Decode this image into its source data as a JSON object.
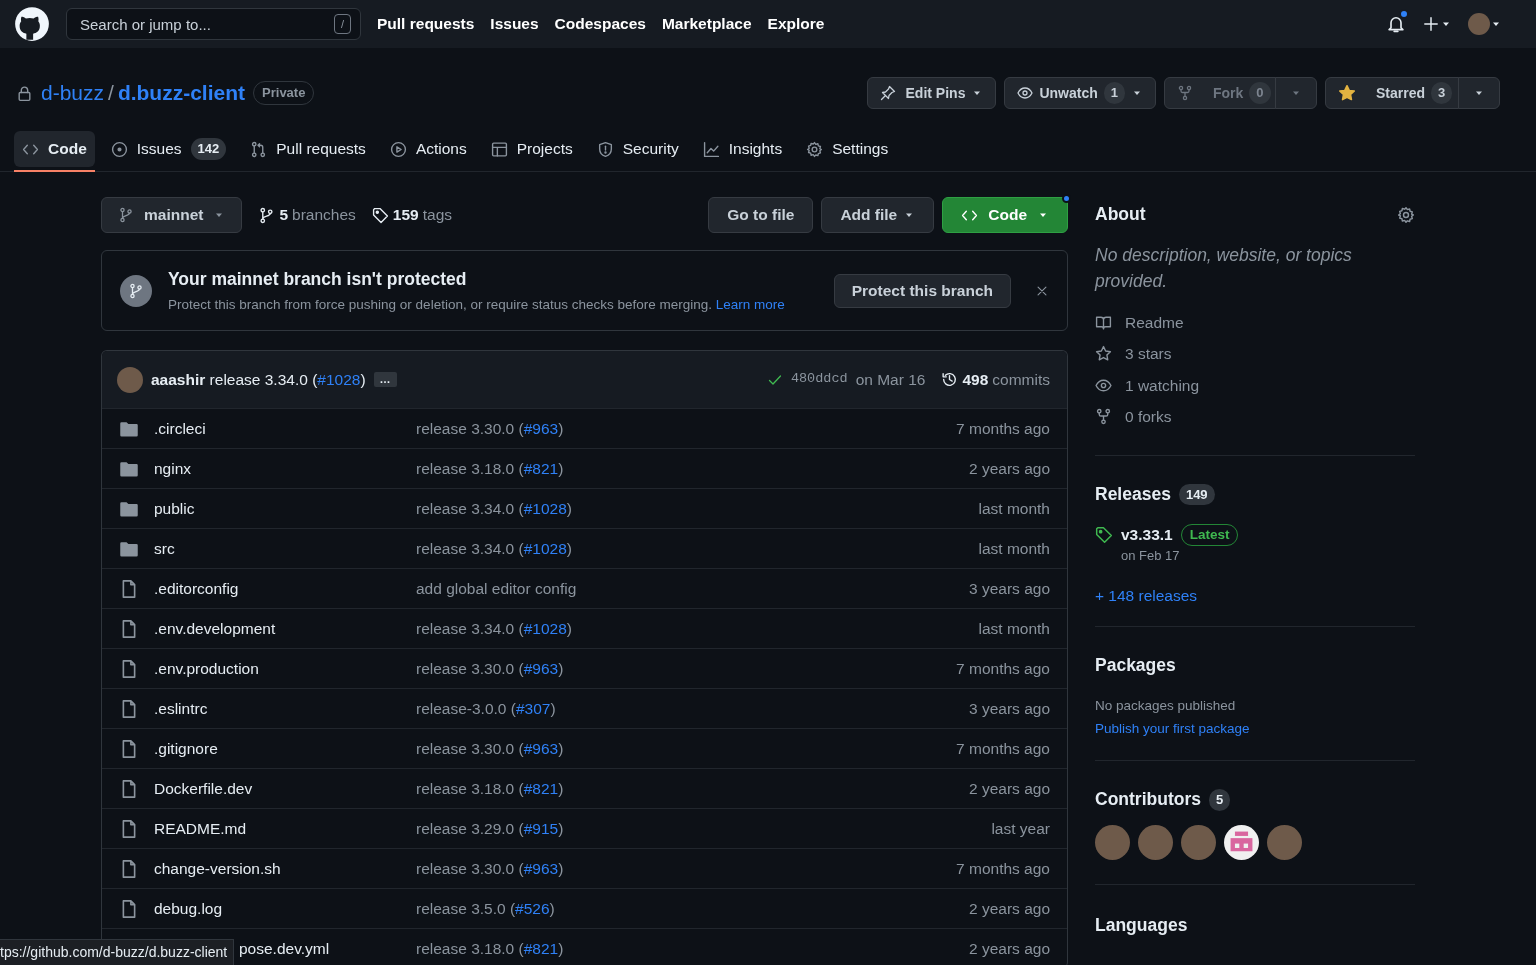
{
  "header": {
    "search_placeholder": "Search or jump to...",
    "search_key": "/",
    "nav": [
      "Pull requests",
      "Issues",
      "Codespaces",
      "Marketplace",
      "Explore"
    ],
    "notification_unread": true
  },
  "repo": {
    "owner": "d-buzz",
    "separator": "/",
    "name": "d.buzz-client",
    "visibility": "Private"
  },
  "repo_actions": [
    {
      "kind": "pins",
      "label": "Edit Pins",
      "disabled": false
    },
    {
      "kind": "watch",
      "label": "Unwatch",
      "count": "1",
      "disabled": false
    },
    {
      "kind": "fork",
      "label": "Fork",
      "count": "0",
      "disabled": true
    },
    {
      "kind": "star",
      "label": "Starred",
      "count": "3",
      "disabled": false
    }
  ],
  "tabs": [
    {
      "kind": "code",
      "label": "Code",
      "selected": true
    },
    {
      "kind": "issue",
      "label": "Issues",
      "count": "142",
      "selected": false
    },
    {
      "kind": "pr",
      "label": "Pull requests",
      "selected": false
    },
    {
      "kind": "play",
      "label": "Actions",
      "selected": false
    },
    {
      "kind": "table",
      "label": "Projects",
      "selected": false
    },
    {
      "kind": "shield",
      "label": "Security",
      "selected": false
    },
    {
      "kind": "graph",
      "label": "Insights",
      "selected": false
    },
    {
      "kind": "gear",
      "label": "Settings",
      "selected": false
    }
  ],
  "toolbar": {
    "branch": "mainnet",
    "branches_count": "5",
    "branches_label": "branches",
    "tags_count": "159",
    "tags_label": "tags",
    "buttons": [
      {
        "kind": "plain",
        "label": "Go to file"
      },
      {
        "kind": "dropdown",
        "label": "Add file"
      },
      {
        "kind": "code",
        "label": "Code"
      }
    ]
  },
  "banner": {
    "title": "Your mainnet branch isn't protected",
    "text": "Protect this branch from force pushing or deletion, or require status checks before merging.",
    "link": "Learn more",
    "button": "Protect this branch"
  },
  "latest_commit": {
    "author": "aaashir",
    "message_parts": [
      {
        "text": "release 3.34.0 ("
      },
      {
        "text": "#1028",
        "link": true
      },
      {
        "text": ")"
      }
    ],
    "more": "…",
    "status_ok": true,
    "sha": "480ddcd",
    "date": "on Mar 16",
    "commits_count": "498",
    "commits_label": "commits"
  },
  "files": [
    {
      "kind": "dir",
      "name": ".circleci",
      "message_parts": [
        {
          "text": "release 3.30.0 ("
        },
        {
          "text": "#963",
          "link": true
        },
        {
          "text": ")"
        }
      ],
      "time": "7 months ago"
    },
    {
      "kind": "dir",
      "name": "nginx",
      "message_parts": [
        {
          "text": "release 3.18.0 ("
        },
        {
          "text": "#821",
          "link": true
        },
        {
          "text": ")"
        }
      ],
      "time": "2 years ago"
    },
    {
      "kind": "dir",
      "name": "public",
      "message_parts": [
        {
          "text": "release 3.34.0 ("
        },
        {
          "text": "#1028",
          "link": true
        },
        {
          "text": ")"
        }
      ],
      "time": "last month"
    },
    {
      "kind": "dir",
      "name": "src",
      "message_parts": [
        {
          "text": "release 3.34.0 ("
        },
        {
          "text": "#1028",
          "link": true
        },
        {
          "text": ")"
        }
      ],
      "time": "last month"
    },
    {
      "kind": "file",
      "name": ".editorconfig",
      "message_parts": [
        {
          "text": "add global editor config"
        }
      ],
      "time": "3 years ago"
    },
    {
      "kind": "file",
      "name": ".env.development",
      "message_parts": [
        {
          "text": "release 3.34.0 ("
        },
        {
          "text": "#1028",
          "link": true
        },
        {
          "text": ")"
        }
      ],
      "time": "last month"
    },
    {
      "kind": "file",
      "name": ".env.production",
      "message_parts": [
        {
          "text": "release 3.30.0 ("
        },
        {
          "text": "#963",
          "link": true
        },
        {
          "text": ")"
        }
      ],
      "time": "7 months ago"
    },
    {
      "kind": "file",
      "name": ".eslintrc",
      "message_parts": [
        {
          "text": "release-3.0.0 ("
        },
        {
          "text": "#307",
          "link": true
        },
        {
          "text": ")"
        }
      ],
      "time": "3 years ago"
    },
    {
      "kind": "file",
      "name": ".gitignore",
      "message_parts": [
        {
          "text": "release 3.30.0 ("
        },
        {
          "text": "#963",
          "link": true
        },
        {
          "text": ")"
        }
      ],
      "time": "7 months ago"
    },
    {
      "kind": "file",
      "name": "Dockerfile.dev",
      "message_parts": [
        {
          "text": "release 3.18.0 ("
        },
        {
          "text": "#821",
          "link": true
        },
        {
          "text": ")"
        }
      ],
      "time": "2 years ago"
    },
    {
      "kind": "file",
      "name": "README.md",
      "message_parts": [
        {
          "text": "release 3.29.0 ("
        },
        {
          "text": "#915",
          "link": true
        },
        {
          "text": ")"
        }
      ],
      "time": "last year"
    },
    {
      "kind": "file",
      "name": "change-version.sh",
      "message_parts": [
        {
          "text": "release 3.30.0 ("
        },
        {
          "text": "#963",
          "link": true
        },
        {
          "text": ")"
        }
      ],
      "time": "7 months ago"
    },
    {
      "kind": "file",
      "name": "debug.log",
      "message_parts": [
        {
          "text": "release 3.5.0 ("
        },
        {
          "text": "#526",
          "link": true
        },
        {
          "text": ")"
        }
      ],
      "time": "2 years ago"
    },
    {
      "kind": "covered",
      "name": "pose.dev.yml",
      "message_parts": [
        {
          "text": "release 3.18.0 ("
        },
        {
          "text": "#821",
          "link": true
        },
        {
          "text": ")"
        }
      ],
      "time": "2 years ago"
    }
  ],
  "status_url": "tps://github.com/d-buzz/d.buzz-client",
  "about": {
    "title": "About",
    "description": "No description, website, or topics provided.",
    "items": [
      {
        "kind": "book",
        "text": "Readme"
      },
      {
        "kind": "star",
        "text": "3 stars"
      },
      {
        "kind": "eye",
        "text": "1 watching"
      },
      {
        "kind": "fork",
        "text": "0 forks"
      }
    ]
  },
  "releases": {
    "title": "Releases",
    "count": "149",
    "tag": "v3.33.1",
    "badge": "Latest",
    "date": "on Feb 17",
    "more": "+ 148 releases"
  },
  "packages": {
    "title": "Packages",
    "text": "No packages published",
    "link": "Publish your first package"
  },
  "contributors": {
    "title": "Contributors",
    "count": "5",
    "avatars": [
      {
        "kind": "photo"
      },
      {
        "kind": "photo"
      },
      {
        "kind": "photo"
      },
      {
        "kind": "identicon",
        "color": "#d9669f"
      },
      {
        "kind": "photo"
      }
    ]
  },
  "languages": {
    "title": "Languages"
  }
}
